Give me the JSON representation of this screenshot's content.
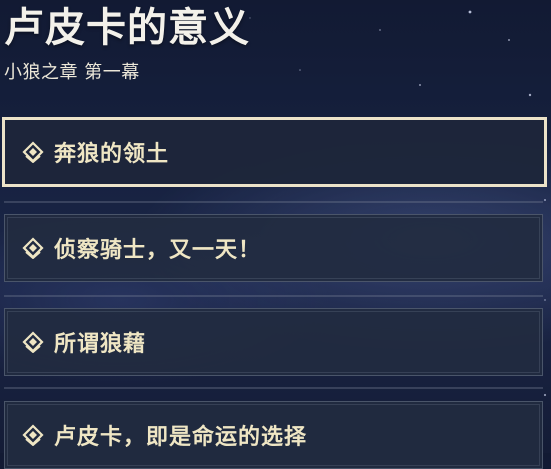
{
  "quest": {
    "title": "卢皮卡的意义",
    "subtitle": "小狼之章 第一幕"
  },
  "chapters": [
    {
      "label": "奔狼的领土",
      "selected": true
    },
    {
      "label": "侦察骑士，又一天！",
      "selected": false
    },
    {
      "label": "所谓狼藉",
      "selected": false
    },
    {
      "label": "卢皮卡，即是命运的选择",
      "selected": false
    }
  ],
  "colors": {
    "title": "#f3f1ea",
    "chapter_text": "#efe6c4",
    "selected_border": "#ece3c9",
    "item_background": "#222b40"
  },
  "icons": {
    "chapter_marker": "quest-diamond-icon"
  }
}
